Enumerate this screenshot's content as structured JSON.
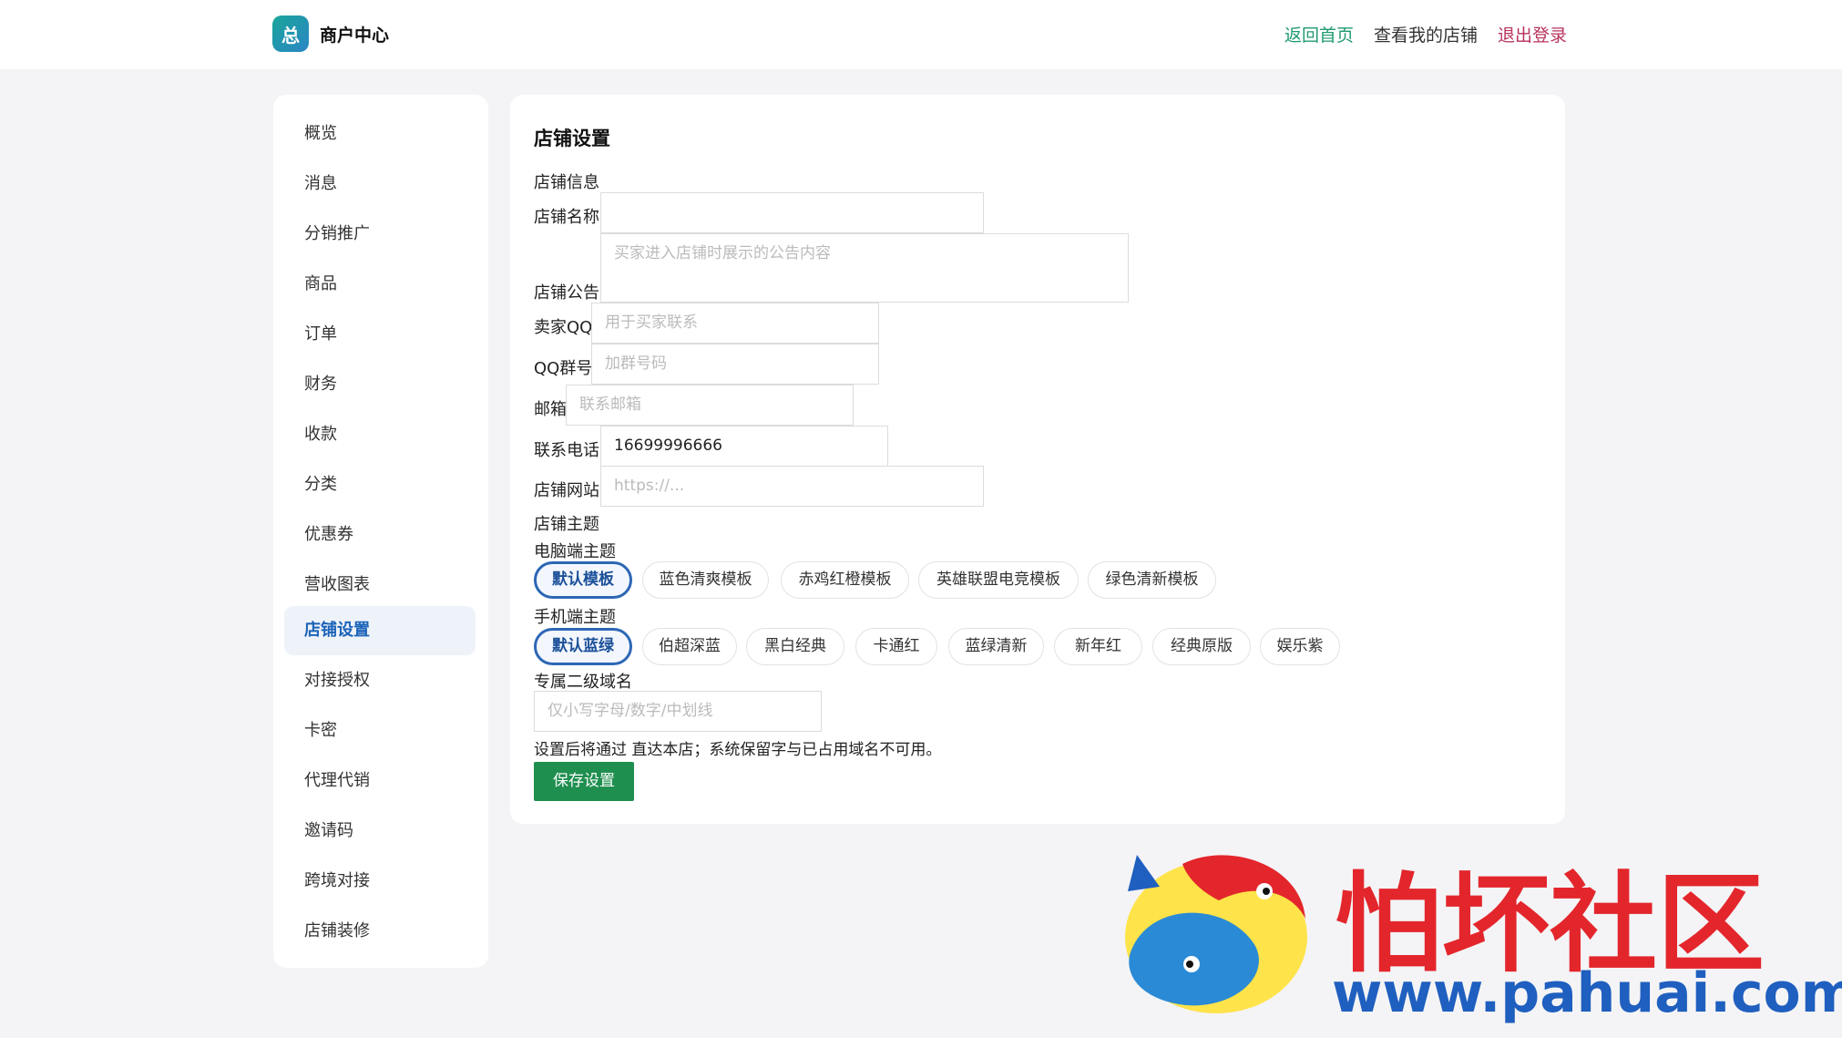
{
  "header": {
    "logo_char": "总",
    "brand": "商户中心",
    "nav": {
      "home": "返回首页",
      "my_shop": "查看我的店铺",
      "logout": "退出登录"
    }
  },
  "sidebar": {
    "items": [
      {
        "label": "概览"
      },
      {
        "label": "消息"
      },
      {
        "label": "分销推广"
      },
      {
        "label": "商品"
      },
      {
        "label": "订单"
      },
      {
        "label": "财务"
      },
      {
        "label": "收款"
      },
      {
        "label": "分类"
      },
      {
        "label": "优惠券"
      },
      {
        "label": "营收图表"
      },
      {
        "label": "店铺设置",
        "active": true
      },
      {
        "label": "对接授权"
      },
      {
        "label": "卡密"
      },
      {
        "label": "代理代销"
      },
      {
        "label": "邀请码"
      },
      {
        "label": "跨境对接"
      },
      {
        "label": "店铺装修"
      }
    ]
  },
  "main": {
    "title": "店铺设置",
    "section_info": "店铺信息",
    "shop_name": {
      "label": "店铺名称",
      "value": "",
      "placeholder": ""
    },
    "announcement": {
      "label": "店铺公告",
      "placeholder": "买家进入店铺时展示的公告内容"
    },
    "seller_qq": {
      "label": "卖家QQ",
      "placeholder": "用于买家联系"
    },
    "qq_group": {
      "label": "QQ群号",
      "placeholder": "加群号码"
    },
    "email": {
      "label": "邮箱",
      "placeholder": "联系邮箱"
    },
    "phone": {
      "label": "联系电话",
      "value": "16699996666"
    },
    "website": {
      "label": "店铺网站",
      "placeholder": "https://..."
    },
    "section_theme": "店铺主题",
    "pc_theme_label": "电脑端主题",
    "pc_themes": [
      "默认模板",
      "蓝色清爽模板",
      "赤鸡红橙模板",
      "英雄联盟电竞模板",
      "绿色清新模板"
    ],
    "pc_selected": "默认模板",
    "mobile_theme_label": "手机端主题",
    "mobile_themes": [
      "默认蓝绿",
      "伯超深蓝",
      "黑白经典",
      "卡通红",
      "蓝绿清新",
      "新年红",
      "经典原版",
      "娱乐紫"
    ],
    "mobile_selected": "默认蓝绿",
    "subdomain": {
      "label": "专属二级域名",
      "placeholder": "仅小写字母/数字/中划线"
    },
    "hint": "设置后将通过 直达本店；系统保留字与已占用域名不可用。",
    "save_label": "保存设置"
  },
  "watermark": {
    "title": "怕坏社区",
    "url": "www.pahuai.com"
  },
  "colors": {
    "accent": "#2d67b5",
    "save": "#1f8f4f",
    "home_link": "#1f9a73",
    "logout_link": "#b8335c"
  }
}
